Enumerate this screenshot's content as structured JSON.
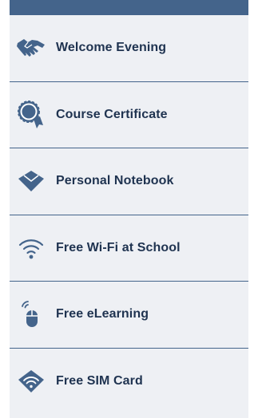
{
  "brand_color": "#44648b",
  "background_color": "#eef0f4",
  "text_color": "#1f3350",
  "benefits": [
    {
      "label": "Welcome Evening",
      "icon": "handshake-icon"
    },
    {
      "label": "Course Certificate",
      "icon": "award-ribbon-icon"
    },
    {
      "label": "Personal Notebook",
      "icon": "notebook-diamond-icon"
    },
    {
      "label": "Free Wi-Fi at School",
      "icon": "wifi-icon"
    },
    {
      "label": "Free eLearning",
      "icon": "wireless-mouse-icon"
    },
    {
      "label": "Free SIM Card",
      "icon": "sim-card-wifi-icon"
    }
  ]
}
